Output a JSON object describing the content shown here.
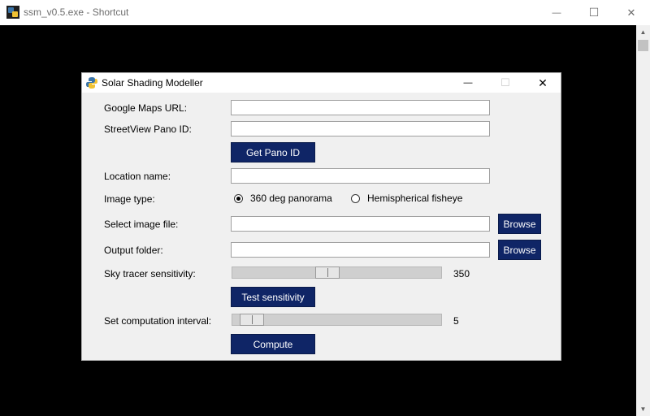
{
  "outer_window": {
    "title": "ssm_v0.5.exe - Shortcut",
    "minimize": "—",
    "maximize": "☐",
    "close": "✕"
  },
  "dialog": {
    "title": "Solar Shading Modeller",
    "minimize": "—",
    "maximize": "☐",
    "close": "✕"
  },
  "form": {
    "google_maps_url": {
      "label": "Google Maps URL:",
      "value": ""
    },
    "streetview_pano_id": {
      "label": "StreetView Pano ID:",
      "value": ""
    },
    "get_pano_button": "Get Pano ID",
    "location_name": {
      "label": "Location name:",
      "value": ""
    },
    "image_type": {
      "label": "Image type:",
      "options": [
        "360 deg panorama",
        "Hemispherical fisheye"
      ],
      "selected": "360 deg panorama"
    },
    "image_file": {
      "label": "Select image file:",
      "value": "",
      "browse": "Browse"
    },
    "output_folder": {
      "label": "Output folder:",
      "value": "",
      "browse": "Browse"
    },
    "sky_tracer": {
      "label": "Sky tracer sensitivity:",
      "value": "350",
      "fraction": 0.45
    },
    "test_button": "Test sensitivity",
    "interval": {
      "label": "Set computation interval:",
      "value": "5",
      "fraction": 0.04
    },
    "compute_button": "Compute"
  },
  "colors": {
    "button_bg": "#0f2566",
    "console_bg": "#000000"
  }
}
